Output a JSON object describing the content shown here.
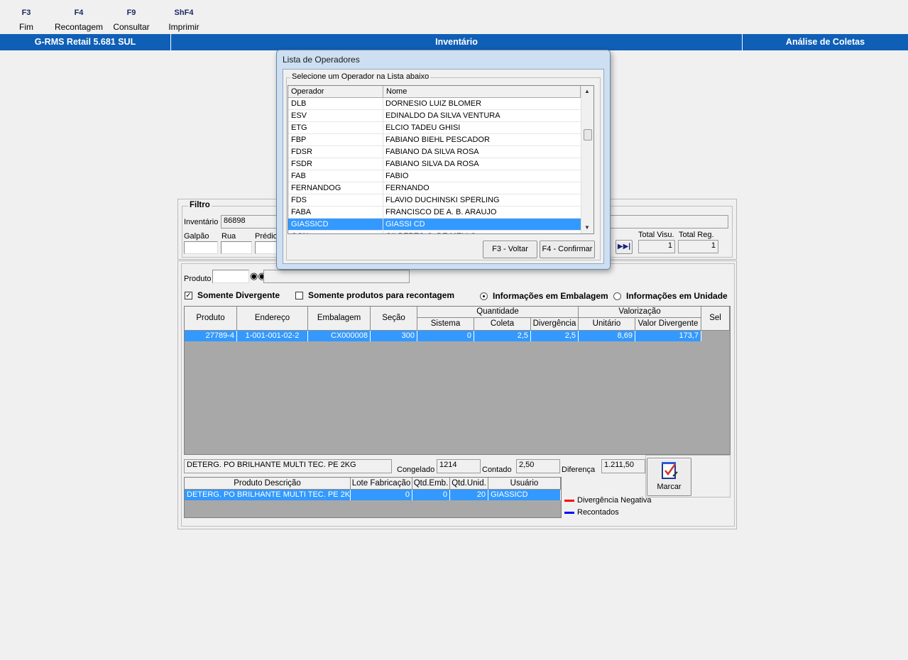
{
  "toolbar": [
    {
      "key": "F3",
      "label": "Fim"
    },
    {
      "key": "F4",
      "label": "Recontagem"
    },
    {
      "key": "F9",
      "label": "Consultar"
    },
    {
      "key": "ShF4",
      "label": "Imprimir"
    }
  ],
  "titlebar": {
    "app": "G-RMS Retail 5.681 SUL",
    "module": "Inventário",
    "screen": "Análise de Coletas"
  },
  "filter": {
    "title": "Filtro",
    "inventario_label": "Inventário",
    "inventario_value": "86898",
    "galpao_label": "Galpão",
    "rua_label": "Rua",
    "predio_label": "Prédio",
    "total_visu_label": "Total Visu.",
    "total_visu_value": "1",
    "total_reg_label": "Total Reg.",
    "total_reg_value": "1"
  },
  "produto": {
    "label": "Produto",
    "value": ""
  },
  "options": {
    "somente_divergente": "Somente Divergente",
    "somente_recontagem": "Somente produtos para recontagem",
    "info_embalagem": "Informações em Embalagem",
    "info_unidade": "Informações em Unidade"
  },
  "grid": {
    "headers": {
      "produto": "Produto",
      "endereco": "Endereço",
      "embalagem": "Embalagem",
      "secao": "Seção",
      "quantidade": "Quantidade",
      "sistema": "Sistema",
      "coleta": "Coleta",
      "divergencia": "Divergência",
      "valorizacao": "Valorização",
      "unitario": "Unitário",
      "valor_divergente": "Valor Divergente",
      "sel": "Sel"
    },
    "rows": [
      {
        "produto": "27789-4",
        "endereco": "1-001-001-02-2",
        "embalagem": "CX000008",
        "secao": "300",
        "sistema": "0",
        "coleta": "2,5",
        "divergencia": "2,5",
        "unitario": "8,69",
        "valor_divergente": "173,7",
        "sel": true
      }
    ]
  },
  "detail": {
    "descricao": "DETERG. PO BRILHANTE MULTI TEC. PE   2KG",
    "congelado_label": "Congelado",
    "congelado_value": "1214",
    "contado_label": "Contado",
    "contado_value": "2,50",
    "diferenca_label": "Diferença",
    "diferenca_value": "1.211,50",
    "marcar_label": "Marcar"
  },
  "subgrid": {
    "headers": {
      "descricao": "Produto Descrição",
      "lote": "Lote Fabricação",
      "qtd_emb": "Qtd.Emb.",
      "qtd_unid": "Qtd.Unid.",
      "usuario": "Usuário"
    },
    "rows": [
      {
        "descricao": "DETERG. PO BRILHANTE MULTI TEC. PE   2KG",
        "lote": "0",
        "qtd_emb": "0",
        "qtd_unid": "20",
        "usuario": "GIASSICD"
      }
    ]
  },
  "legend": {
    "negativa": "Divergência Negativa",
    "recontados": "Recontados",
    "negativa_color": "#ff0000",
    "recontados_color": "#0000ff"
  },
  "modal": {
    "title": "Lista de Operadores",
    "group": "Selecione um Operador na Lista abaixo",
    "col_operador": "Operador",
    "col_nome": "Nome",
    "rows": [
      {
        "op": "DLB",
        "nome": "DORNESIO LUIZ BLOMER"
      },
      {
        "op": "ESV",
        "nome": "EDINALDO DA SILVA VENTURA"
      },
      {
        "op": "ETG",
        "nome": "ELCIO TADEU GHISI"
      },
      {
        "op": "FBP",
        "nome": "FABIANO BIEHL PESCADOR"
      },
      {
        "op": "FDSR",
        "nome": "FABIANO DA SILVA ROSA"
      },
      {
        "op": "FSDR",
        "nome": "FABIANO SILVA DA ROSA"
      },
      {
        "op": "FAB",
        "nome": "FABIO"
      },
      {
        "op": "FERNANDOG",
        "nome": "FERNANDO"
      },
      {
        "op": "FDS",
        "nome": "FLAVIO DUCHINSKI SPERLING"
      },
      {
        "op": "FABA",
        "nome": "FRANCISCO DE A. B. ARAUJO"
      },
      {
        "op": "GIASSICD",
        "nome": "GIASSI CD"
      },
      {
        "op": "GCN",
        "nome": "GILBERTO C. DE MELLO"
      }
    ],
    "selected_index": 10,
    "btn_voltar": "F3 - Voltar",
    "btn_confirmar": "F4 - Confirmar"
  },
  "colors": {
    "titlebar": "#0f5fb6",
    "selection": "#3399ff",
    "grid_bg": "#a8a8a8"
  }
}
